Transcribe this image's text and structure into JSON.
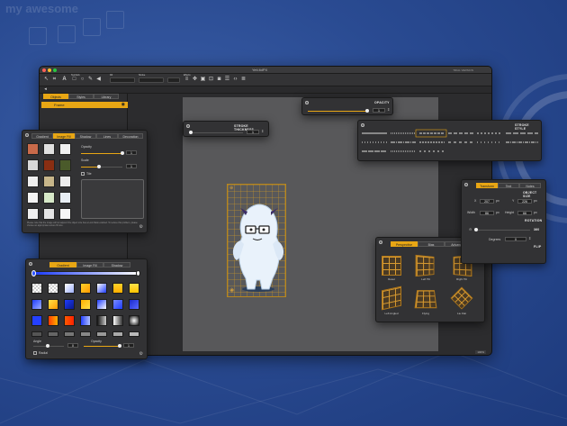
{
  "background": {
    "color": "#2a4b92",
    "deco_text": "my awesome"
  },
  "window": {
    "title": "Yeti.ltdPX",
    "traffic_lights": [
      "#ff5f57",
      "#febc2e",
      "#28c840"
    ],
    "toolbar_labels": {
      "symbols": "Symbols",
      "fill": "Fill",
      "stroke": "Stroke",
      "effects": "Effects"
    },
    "right_badge": "TRIAL VERSION",
    "zoom": "100%"
  },
  "sidebar": {
    "tabs": [
      "Objects",
      "Styles",
      "Library"
    ],
    "active_tab": 0,
    "selected_item": "Frame"
  },
  "stroke_panel": {
    "title": "STROKE THICKNESS",
    "value": "1"
  },
  "opacity_top_panel": {
    "title": "OPACITY",
    "value": "1"
  },
  "stroke_style_panel": {
    "title": "STROKE STYLE"
  },
  "image_fill_panel": {
    "tabs": [
      "Gradient",
      "Image Fill",
      "Shadow",
      "Lines",
      "Decoration"
    ],
    "active_tab": 1,
    "opacity_label": "Opacity",
    "opacity_value": "1",
    "scale_label": "Scale",
    "scale_value": "1",
    "tile_label": "Tile",
    "hint": "Please note that the image will not adjust if the object size has a Lock Ratio enabled. To reduce this problem, please choose an appropriate texture fill size."
  },
  "gradient_panel": {
    "tabs": [
      "Gradient",
      "Image Fill",
      "Shadow"
    ],
    "active_tab": 0,
    "angle_label": "Angle",
    "angle_value": "0",
    "opacity_label": "Opacity",
    "opacity_value": "1",
    "radial_label": "Radial"
  },
  "perspective_panel": {
    "tabs": [
      "Perspective",
      "Bias",
      "Advanced"
    ],
    "active_tab": 0,
    "items": [
      "Reset",
      "Left Tilt",
      "Right Tilt",
      "Left Angled",
      "Flying",
      "Lie Flat"
    ]
  },
  "object_panel": {
    "tabs": [
      "Transform",
      "Text",
      "Notes"
    ],
    "active_tab": 0,
    "title": "OBJECT SIZE",
    "x_label": "X",
    "x_value": "207",
    "y_label": "Y",
    "y_value": "226",
    "width_label": "Width",
    "width_value": "86",
    "height_label": "Height",
    "height_value": "66",
    "unit": "px",
    "rotation_title": "ROTATION",
    "degrees_label": "Degrees",
    "degrees_value": "0",
    "flip_label": "FLIP",
    "more_label": "360"
  },
  "colors": {
    "accent": "#e8a614",
    "panel": "#323234"
  }
}
